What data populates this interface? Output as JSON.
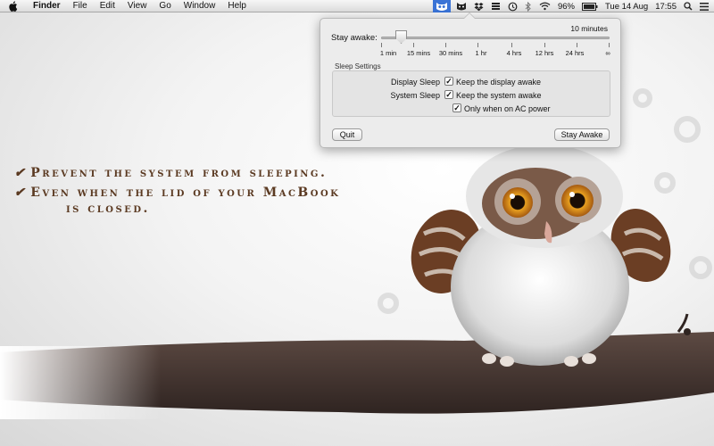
{
  "menubar": {
    "apple_icon": "apple-icon",
    "app_name": "Finder",
    "menus": [
      "File",
      "Edit",
      "View",
      "Go",
      "Window",
      "Help"
    ],
    "status_icons": [
      "owl-menu-icon",
      "cat-icon",
      "dropbox-icon",
      "bars-icon",
      "time-machine-icon",
      "bluetooth-icon",
      "wifi-icon",
      "battery-icon"
    ],
    "battery_percent": "96%",
    "date": "Tue 14 Aug",
    "time": "17:55",
    "right_icons_end": [
      "search-icon",
      "list-icon"
    ]
  },
  "popup": {
    "stay_awake_label": "Stay awake:",
    "current_value": "10 minutes",
    "slider_value_minutes": 10,
    "tick_labels": [
      "1 min",
      "15 mins",
      "30 mins",
      "1 hr",
      "4 hrs",
      "12 hrs",
      "24 hrs",
      "∞"
    ],
    "sleep_settings_title": "Sleep Settings",
    "display_sleep_label": "Display Sleep",
    "display_sleep_option": "Keep the display awake",
    "display_sleep_checked": true,
    "system_sleep_label": "System Sleep",
    "system_sleep_option": "Keep the system awake",
    "system_sleep_checked": true,
    "ac_power_option": "Only when on AC power",
    "ac_power_checked": true,
    "quit_label": "Quit",
    "stay_awake_button": "Stay Awake"
  },
  "tagline": {
    "check": "✔",
    "line1": "Prevent the system from sleeping.",
    "line2": "Even when the lid of your MacBook",
    "line3": "is closed."
  },
  "colors": {
    "menubar_highlight": "#3a73d6",
    "tagline": "#5b3a22"
  }
}
